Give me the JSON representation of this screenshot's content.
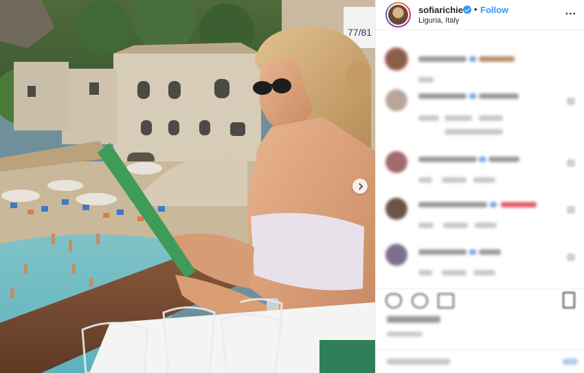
{
  "post": {
    "username": "sofiarichie",
    "verified_icon": "verified-badge-icon",
    "separator": "•",
    "follow_label": "Follow",
    "location": "Liguria, Italy",
    "more_icon_text": "...",
    "sign_text": "77/81"
  },
  "colors": {
    "link_blue": "#3897f0",
    "text": "#262626",
    "border": "#efefef"
  },
  "icons": {
    "carousel_next": "chevron-right-icon",
    "like": "heart-icon",
    "comment": "comment-icon",
    "share": "share-icon",
    "save": "bookmark-icon"
  }
}
